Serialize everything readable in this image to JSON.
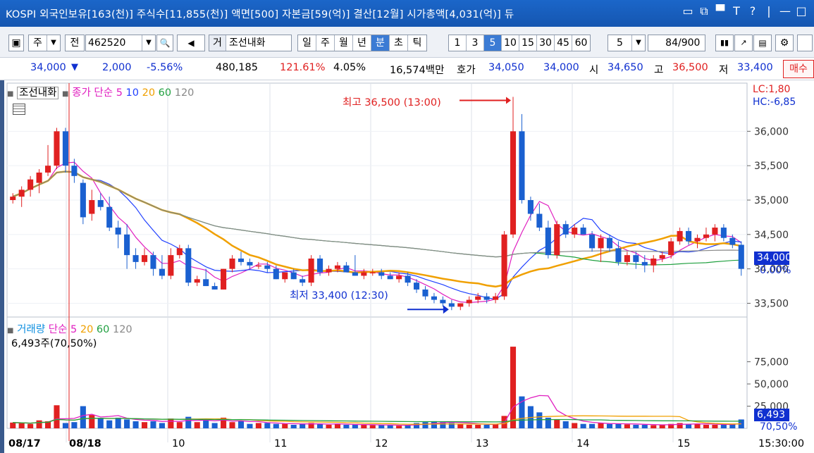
{
  "window": {
    "title": "KOSPI 외국인보유[163(천)] 주식수[11,855(천)] 액면[500] 자본금[59(억)] 결산[12월] 시가총액[4,031(억)] 듀",
    "controls": [
      "▭",
      "⧉",
      "▀",
      "T",
      "?",
      "|",
      "—",
      "□",
      "×"
    ]
  },
  "toolbar": {
    "icon_left": "▣",
    "type_select": "주",
    "type_arrow": "▼",
    "jeon_label": "전",
    "code_value": "462520",
    "code_arrow": "▼",
    "search_icon": "🔍",
    "sound_icon": "◀",
    "name_prefix": "거",
    "stock_name": "조선내화",
    "period_tabs": [
      "일",
      "주",
      "월",
      "년",
      "분",
      "초",
      "틱"
    ],
    "period_selected": "분",
    "interval_tabs": [
      "1",
      "3",
      "5",
      "10",
      "15",
      "30",
      "45",
      "60"
    ],
    "interval_selected": "5",
    "interval_value": "5",
    "count_value": "84",
    "count_total": "/900",
    "tool_icons": [
      "candle-icon",
      "line-tool-icon",
      "save-icon",
      "gear-icon"
    ]
  },
  "price_bar": {
    "price": "34,000",
    "direction": "▼",
    "change": "2,000",
    "change_pct": "-5.56%",
    "volume": "480,185",
    "volume_ratio": "121.61%",
    "turnover": "4.05%",
    "amount": "16,574백만",
    "bid_label": "호가",
    "bid": "34,050",
    "ask": "34,000",
    "open_label": "시",
    "open": "34,650",
    "high_label": "고",
    "high": "36,500",
    "low_label": "저",
    "low": "33,400",
    "trade_button": "매수"
  },
  "chart_main": {
    "legend_name": "조선내화",
    "legend_ma": "종가 단순",
    "ma_periods": [
      "5",
      "10",
      "20",
      "60",
      "120"
    ],
    "ma_colors": [
      "#e020c0",
      "#2040ff",
      "#f0a000",
      "#20a040",
      "#888888"
    ],
    "lc": "LC:1,80",
    "hc": "HC:-6,85",
    "high_annot": "최고 36,500 (13:00)",
    "low_annot": "최저 33,400 (12:30)",
    "current_price_box": "34,000",
    "current_pct": "0.00%"
  },
  "chart_volume": {
    "legend_name": "거래량",
    "legend_ma": "단순",
    "ma_periods": [
      "5",
      "20",
      "60",
      "120"
    ],
    "current": "6,493주(70,50%)",
    "current_box": "6,493",
    "current_pct": "70,50%"
  },
  "axis": {
    "x_labels": [
      "08/17",
      "08/18",
      "10",
      "11",
      "12",
      "13",
      "14",
      "15",
      "15:30:00"
    ]
  },
  "chart_data": {
    "type": "candlestick",
    "price_y_ticks": [
      33500,
      34000,
      34500,
      35000,
      35500,
      36000
    ],
    "price_y_range": [
      33300,
      36700
    ],
    "volume_y_ticks": [
      25000,
      50000,
      75000
    ],
    "volume_y_range": [
      0,
      100000
    ],
    "ohlc": [
      [
        35000,
        35100,
        34950,
        35050
      ],
      [
        35050,
        35200,
        34900,
        35150
      ],
      [
        35150,
        35350,
        35050,
        35300
      ],
      [
        35250,
        35450,
        35100,
        35400
      ],
      [
        35400,
        35800,
        35350,
        35500
      ],
      [
        35500,
        36050,
        35450,
        36000
      ],
      [
        36000,
        36050,
        35400,
        35500
      ],
      [
        35500,
        35600,
        35250,
        35350
      ],
      [
        35250,
        35300,
        34650,
        34750
      ],
      [
        34800,
        35150,
        34700,
        35000
      ],
      [
        35000,
        35100,
        34850,
        34900
      ],
      [
        34900,
        35050,
        34550,
        34600
      ],
      [
        34600,
        34700,
        34300,
        34500
      ],
      [
        34500,
        34650,
        34000,
        34200
      ],
      [
        34200,
        34300,
        34000,
        34100
      ],
      [
        34100,
        34300,
        34050,
        34200
      ],
      [
        34200,
        34250,
        33900,
        34000
      ],
      [
        34000,
        34200,
        33850,
        33900
      ],
      [
        33900,
        34300,
        33850,
        34200
      ],
      [
        34200,
        34350,
        34150,
        34300
      ],
      [
        34300,
        34350,
        33750,
        33800
      ],
      [
        33800,
        33900,
        33750,
        33850
      ],
      [
        33850,
        34000,
        33750,
        33750
      ],
      [
        33750,
        33800,
        33700,
        33700
      ],
      [
        33700,
        34000,
        33700,
        34000
      ],
      [
        34000,
        34200,
        33950,
        34150
      ],
      [
        34150,
        34250,
        34050,
        34100
      ],
      [
        34100,
        34150,
        34000,
        34050
      ],
      [
        34050,
        34100,
        34000,
        34050
      ],
      [
        34050,
        34100,
        33950,
        34000
      ],
      [
        34000,
        34050,
        33850,
        33850
      ],
      [
        33850,
        33950,
        33800,
        33950
      ],
      [
        33950,
        34000,
        33850,
        33850
      ],
      [
        33850,
        33900,
        33750,
        33800
      ],
      [
        33800,
        34200,
        33750,
        34150
      ],
      [
        34150,
        34200,
        33900,
        33950
      ],
      [
        33950,
        34050,
        33900,
        34000
      ],
      [
        34000,
        34100,
        33950,
        34050
      ],
      [
        34050,
        34100,
        33950,
        33950
      ],
      [
        33950,
        34200,
        33900,
        33900
      ],
      [
        33900,
        34000,
        33850,
        33950
      ],
      [
        33950,
        34000,
        33900,
        33950
      ],
      [
        33950,
        34000,
        33850,
        33900
      ],
      [
        33900,
        33950,
        33850,
        33850
      ],
      [
        33850,
        33950,
        33800,
        33900
      ],
      [
        33900,
        33950,
        33750,
        33800
      ],
      [
        33800,
        33850,
        33650,
        33700
      ],
      [
        33700,
        33750,
        33550,
        33600
      ],
      [
        33600,
        33650,
        33500,
        33550
      ],
      [
        33550,
        33600,
        33450,
        33500
      ],
      [
        33500,
        33550,
        33400,
        33450
      ],
      [
        33450,
        33500,
        33400,
        33500
      ],
      [
        33500,
        33600,
        33450,
        33550
      ],
      [
        33550,
        33650,
        33500,
        33600
      ],
      [
        33600,
        33650,
        33500,
        33550
      ],
      [
        33550,
        33650,
        33500,
        33600
      ],
      [
        33600,
        34550,
        33550,
        34500
      ],
      [
        34500,
        36500,
        34450,
        36000
      ],
      [
        36000,
        36250,
        34950,
        35000
      ],
      [
        35000,
        35050,
        34700,
        34800
      ],
      [
        34800,
        34950,
        34550,
        34600
      ],
      [
        34600,
        34700,
        34150,
        34200
      ],
      [
        34200,
        34700,
        34150,
        34650
      ],
      [
        34650,
        34700,
        34450,
        34500
      ],
      [
        34500,
        34650,
        34450,
        34600
      ],
      [
        34600,
        34650,
        34500,
        34500
      ],
      [
        34500,
        34550,
        34250,
        34300
      ],
      [
        34300,
        34500,
        34100,
        34450
      ],
      [
        34450,
        34500,
        34250,
        34300
      ],
      [
        34300,
        34400,
        34050,
        34100
      ],
      [
        34100,
        34250,
        34050,
        34200
      ],
      [
        34200,
        34250,
        34000,
        34100
      ],
      [
        34100,
        34200,
        33950,
        34050
      ],
      [
        34050,
        34200,
        33950,
        34150
      ],
      [
        34150,
        34250,
        34100,
        34200
      ],
      [
        34200,
        34450,
        34150,
        34400
      ],
      [
        34400,
        34600,
        34350,
        34550
      ],
      [
        34550,
        34600,
        34350,
        34400
      ],
      [
        34400,
        34500,
        34300,
        34450
      ],
      [
        34450,
        34600,
        34400,
        34500
      ],
      [
        34500,
        34650,
        34400,
        34600
      ],
      [
        34600,
        34650,
        34400,
        34450
      ],
      [
        34450,
        34500,
        34300,
        34350
      ],
      [
        34350,
        34400,
        33900,
        34000
      ]
    ],
    "volume": [
      6500,
      6000,
      5000,
      9000,
      8000,
      26000,
      6000,
      7000,
      25000,
      15000,
      11000,
      9000,
      12000,
      10000,
      8000,
      7000,
      8000,
      6000,
      11000,
      7000,
      13000,
      7000,
      9000,
      6000,
      12000,
      7000,
      8000,
      5000,
      6000,
      6000,
      5000,
      5000,
      4000,
      5000,
      6000,
      5000,
      4000,
      5000,
      4000,
      4000,
      4000,
      3500,
      4000,
      3500,
      3000,
      3500,
      6000,
      7000,
      8000,
      7000,
      6000,
      5000,
      4000,
      4000,
      4000,
      5000,
      14000,
      92000,
      36000,
      25000,
      18000,
      12000,
      10000,
      8000,
      6000,
      5000,
      5000,
      6000,
      5000,
      5000,
      4500,
      4000,
      4000,
      3500,
      4000,
      5000,
      6000,
      5000,
      5000,
      4000,
      4000,
      4000,
      5000,
      10000
    ]
  }
}
